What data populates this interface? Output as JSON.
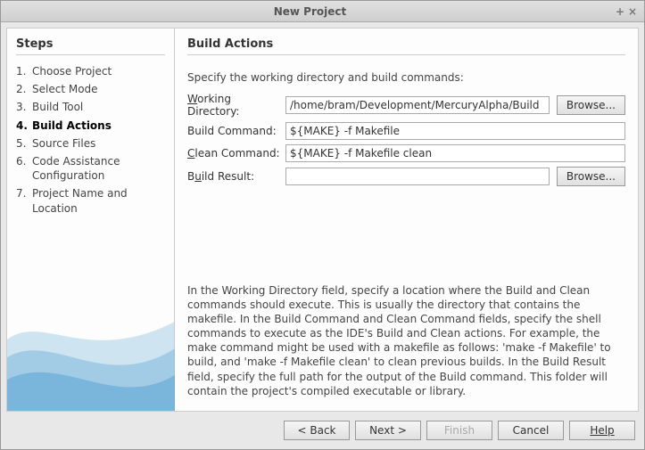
{
  "window": {
    "title": "New Project"
  },
  "sidebar": {
    "heading": "Steps",
    "items": [
      {
        "num": "1.",
        "label": "Choose Project"
      },
      {
        "num": "2.",
        "label": "Select Mode"
      },
      {
        "num": "3.",
        "label": "Build Tool"
      },
      {
        "num": "4.",
        "label": "Build Actions",
        "active": true
      },
      {
        "num": "5.",
        "label": "Source Files"
      },
      {
        "num": "6.",
        "label": "Code Assistance Configuration"
      },
      {
        "num": "7.",
        "label": "Project Name and Location"
      }
    ]
  },
  "main": {
    "heading": "Build Actions",
    "intro": "Specify the working directory and build commands:",
    "fields": {
      "workdir": {
        "label_pre": "",
        "label_u": "W",
        "label_post": "orking Directory:",
        "value": "/home/bram/Development/MercuryAlpha/Build",
        "browse": "Browse..."
      },
      "buildcmd": {
        "label": "Build Command:",
        "value": "${MAKE} -f Makefile"
      },
      "cleancmd": {
        "label_pre": "",
        "label_u": "C",
        "label_post": "lean Command:",
        "value": "${MAKE} -f Makefile clean"
      },
      "buildres": {
        "label_pre": "B",
        "label_u": "u",
        "label_post": "ild Result:",
        "value": "",
        "browse": "Browse..."
      }
    },
    "help": "In the Working Directory field, specify a location where the Build and Clean commands should execute. This is usually the directory that contains the makefile. In the Build Command and Clean Command fields, specify the shell commands to execute as the IDE's Build and Clean actions. For example, the make command might be used with a makefile as follows: 'make -f Makefile' to build, and 'make -f Makefile clean' to clean previous builds. In the Build Result field, specify the full path for the output of the Build command. This folder will contain the project's compiled executable or library."
  },
  "footer": {
    "back": "< Back",
    "next": "Next >",
    "finish": "Finish",
    "cancel": "Cancel",
    "help": "Help"
  }
}
